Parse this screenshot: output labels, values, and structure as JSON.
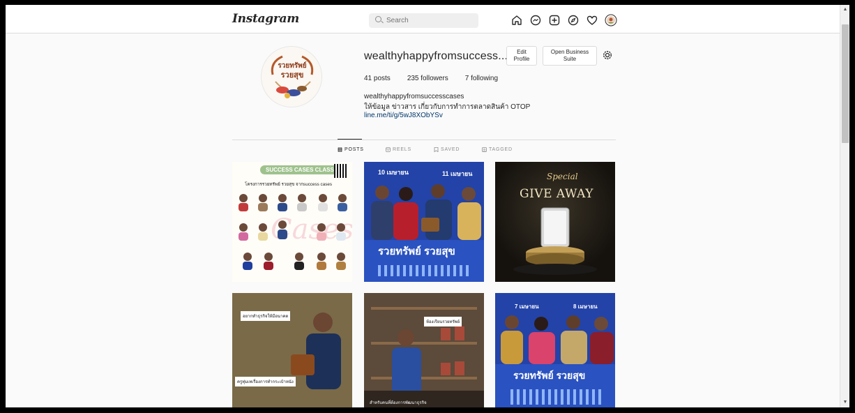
{
  "app": {
    "logo": "Instagram"
  },
  "search": {
    "placeholder": "Search"
  },
  "nav_icons": [
    "home-icon",
    "messenger-icon",
    "new-post-icon",
    "explore-icon",
    "activity-heart-icon",
    "profile-avatar-icon"
  ],
  "profile": {
    "username": "wealthyhappyfromsuccess...",
    "edit_line1": "Edit",
    "edit_line2": "Profile",
    "suite_line1": "Open Business",
    "suite_line2": "Suite",
    "posts_count": "41",
    "posts_label": "posts",
    "followers_count": "235",
    "followers_label": "followers",
    "following_count": "7",
    "following_label": "following",
    "bio_name": "wealthyhappyfromsuccesscases",
    "bio_text": "ให้ข้อมูล ข่าวสาร เกี่ยวกับการทำการตลาดสินค้า OTOP",
    "link": "line.me/ti/g/5wJ8XObYSv"
  },
  "avatar_logo": {
    "line1": "รวยทรัพย์",
    "line2": "รวยสุข"
  },
  "tabs": [
    {
      "label": "POSTS",
      "icon": "grid-icon",
      "active": true
    },
    {
      "label": "REELS",
      "icon": "reels-icon",
      "active": false
    },
    {
      "label": "SAVED",
      "icon": "bookmark-icon",
      "active": false
    },
    {
      "label": "TAGGED",
      "icon": "tag-icon",
      "active": false
    }
  ],
  "posts": {
    "p1": {
      "badge": "SUCCESS CASES CLASS",
      "title": "โครงการรวยทรัพย์ รวยสุข จากsuccess cases"
    },
    "p2": {
      "date_left": "10 เมษายน",
      "date_right": "11 เมษายน",
      "banner": "รวยทรัพย์ รวยสุข"
    },
    "p3": {
      "script": "Special",
      "title": "GIVE AWAY"
    },
    "p4": {
      "caption_top": "อยากทำธุรกิจให้มีอนาคต",
      "caption_bottom": "ครูทุ่มเทเรื่องการทำกระเป๋าหนัง"
    },
    "p5": {
      "caption_top": "ห้องเรียนรวยทรัพย์",
      "caption_bottom": "สำหรับคนที่ต้องการพัฒนาธุรกิจ"
    },
    "p6": {
      "date_left": "7 เมษายน",
      "date_right": "8 เมษายน",
      "banner": "รวยทรัพย์ รวยสุข"
    }
  },
  "colors": {
    "accent_link": "#00376b",
    "border": "#dbdbdb",
    "text": "#262626",
    "muted": "#8e8e8e",
    "post_blue": "#1f3f9e"
  }
}
